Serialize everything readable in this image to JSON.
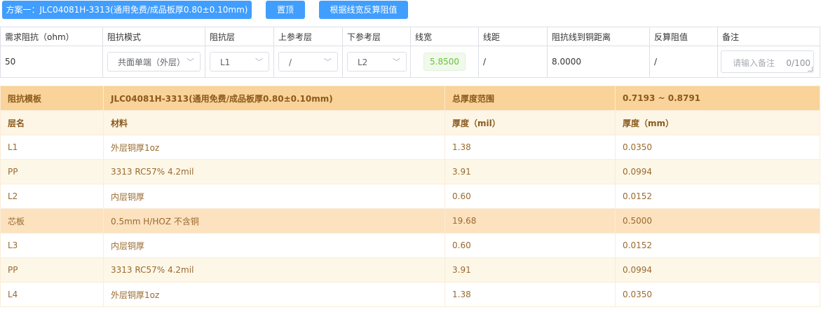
{
  "buttons": {
    "plan": "方案一：JLC04081H-3313(通用免费/成品板厚0.80±0.10mm)",
    "top": "置顶",
    "reverse": "根据线宽反算阻值"
  },
  "impedance": {
    "headers": [
      "需求阻抗（ohm）",
      "阻抗模式",
      "阻抗层",
      "上参考层",
      "下参考层",
      "线宽",
      "线距",
      "阻抗线到铜距离",
      "反算阻值",
      "备注"
    ],
    "required": "50",
    "mode": "共面单端（外层）",
    "layer": "L1",
    "upper_ref": "/",
    "lower_ref": "L2",
    "line_width": "5.8500",
    "line_spacing": "/",
    "copper_distance": "8.0000",
    "reverse_value": "/",
    "remark_placeholder": "请输入备注",
    "remark_count": "0/100"
  },
  "stack": {
    "template_label": "阻抗模板",
    "template_value": "JLC04081H-3313(通用免费/成品板厚0.80±0.10mm)",
    "thickness_label": "总厚度范围",
    "thickness_value": "0.7193 ~ 0.8791",
    "columns": [
      "层名",
      "材料",
      "厚度（mil）",
      "厚度（mm）"
    ],
    "rows": [
      {
        "layer": "L1",
        "material": "外层铜厚1oz",
        "mil": "1.38",
        "mm": "0.0350"
      },
      {
        "layer": "PP",
        "material": "3313 RC57% 4.2mil",
        "mil": "3.91",
        "mm": "0.0994"
      },
      {
        "layer": "L2",
        "material": "内层铜厚",
        "mil": "0.60",
        "mm": "0.0152"
      },
      {
        "layer": "芯板",
        "material": "0.5mm H/HOZ 不含铜",
        "mil": "19.68",
        "mm": "0.5000"
      },
      {
        "layer": "L3",
        "material": "内层铜厚",
        "mil": "0.60",
        "mm": "0.0152"
      },
      {
        "layer": "PP",
        "material": "3313 RC57% 4.2mil",
        "mil": "3.91",
        "mm": "0.0994"
      },
      {
        "layer": "L4",
        "material": "外层铜厚1oz",
        "mil": "1.38",
        "mm": "0.0350"
      }
    ]
  }
}
